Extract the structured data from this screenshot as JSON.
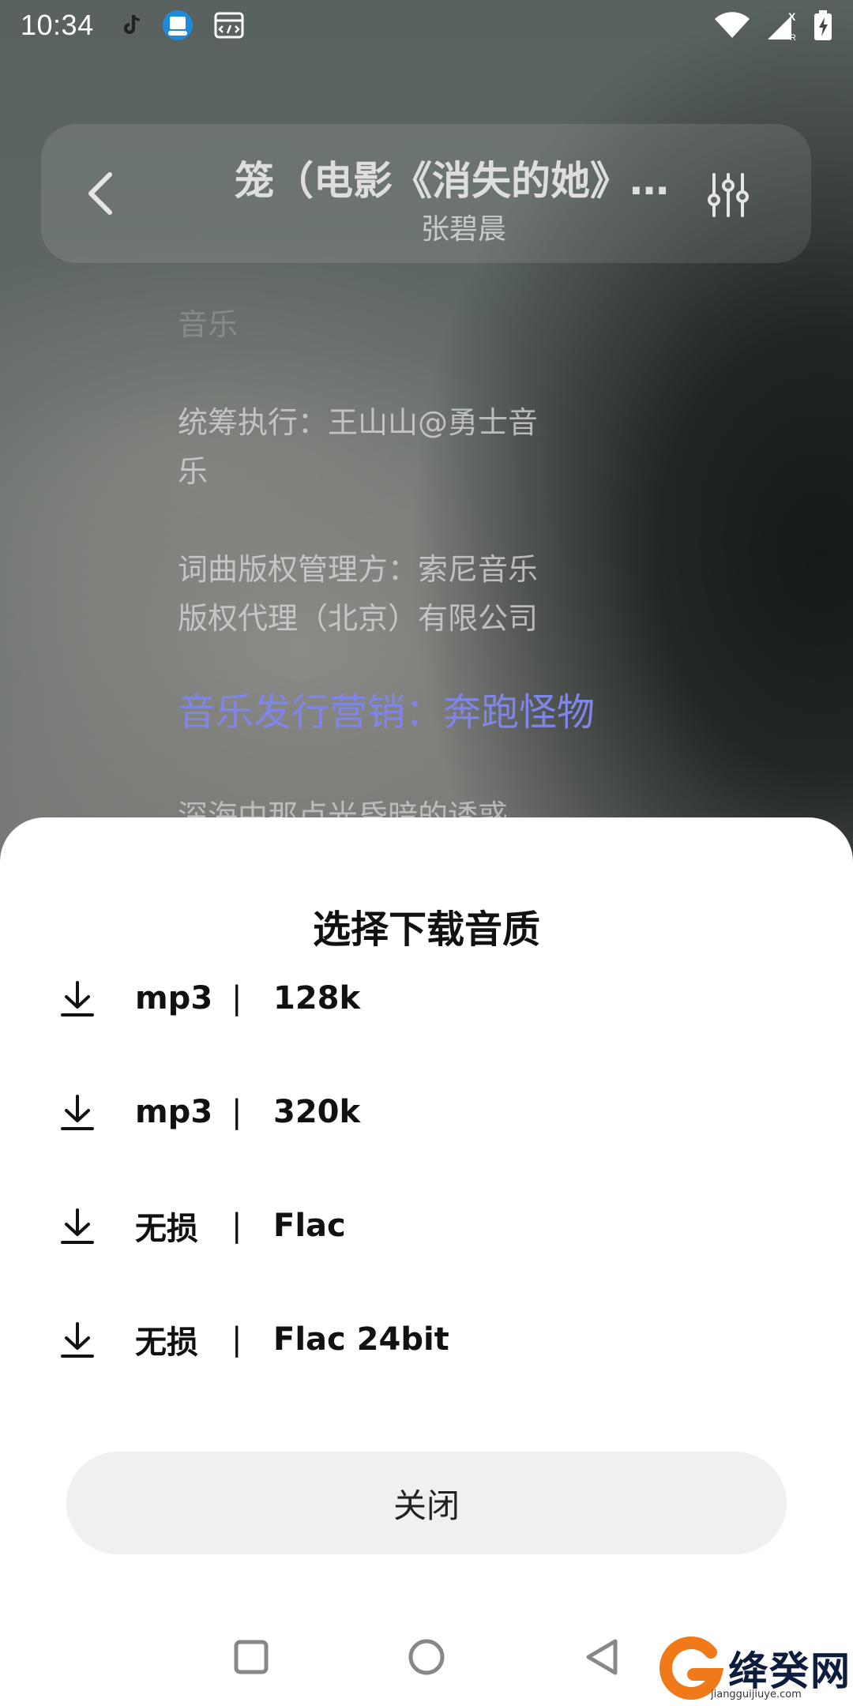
{
  "status_bar": {
    "time": "10:34",
    "icons": [
      "tiktok-icon",
      "app-badge-icon",
      "browser-icon",
      "wifi-icon",
      "signal-icon",
      "battery-charging-icon"
    ]
  },
  "header": {
    "title": "笼（电影《消失的她》…",
    "artist": "张碧晨"
  },
  "lyrics": {
    "top_partial": "音乐",
    "line1a": "统筹执行：王山山@勇士音",
    "line1b": "乐",
    "line2a": "词曲版权管理方：索尼音乐",
    "line2b": "版权代理（北京）有限公司",
    "active": "音乐发行营销：奔跑怪物",
    "bottom_partial": "深海中那点光昏暗的诱惑"
  },
  "sheet": {
    "title": "选择下载音质",
    "separator": "|",
    "options": [
      {
        "format": "mp3",
        "quality": "128k"
      },
      {
        "format": "mp3",
        "quality": "320k"
      },
      {
        "format": "无损",
        "quality": "Flac"
      },
      {
        "format": "无损",
        "quality": "Flac 24bit"
      }
    ],
    "close_label": "关闭"
  },
  "watermark": {
    "text": "绛癸网",
    "url": "jiangguijiuye.com"
  },
  "colors": {
    "active_lyric": "#7f86e8",
    "sheet_bg": "#ffffff",
    "close_bg": "#f0f0f0"
  }
}
